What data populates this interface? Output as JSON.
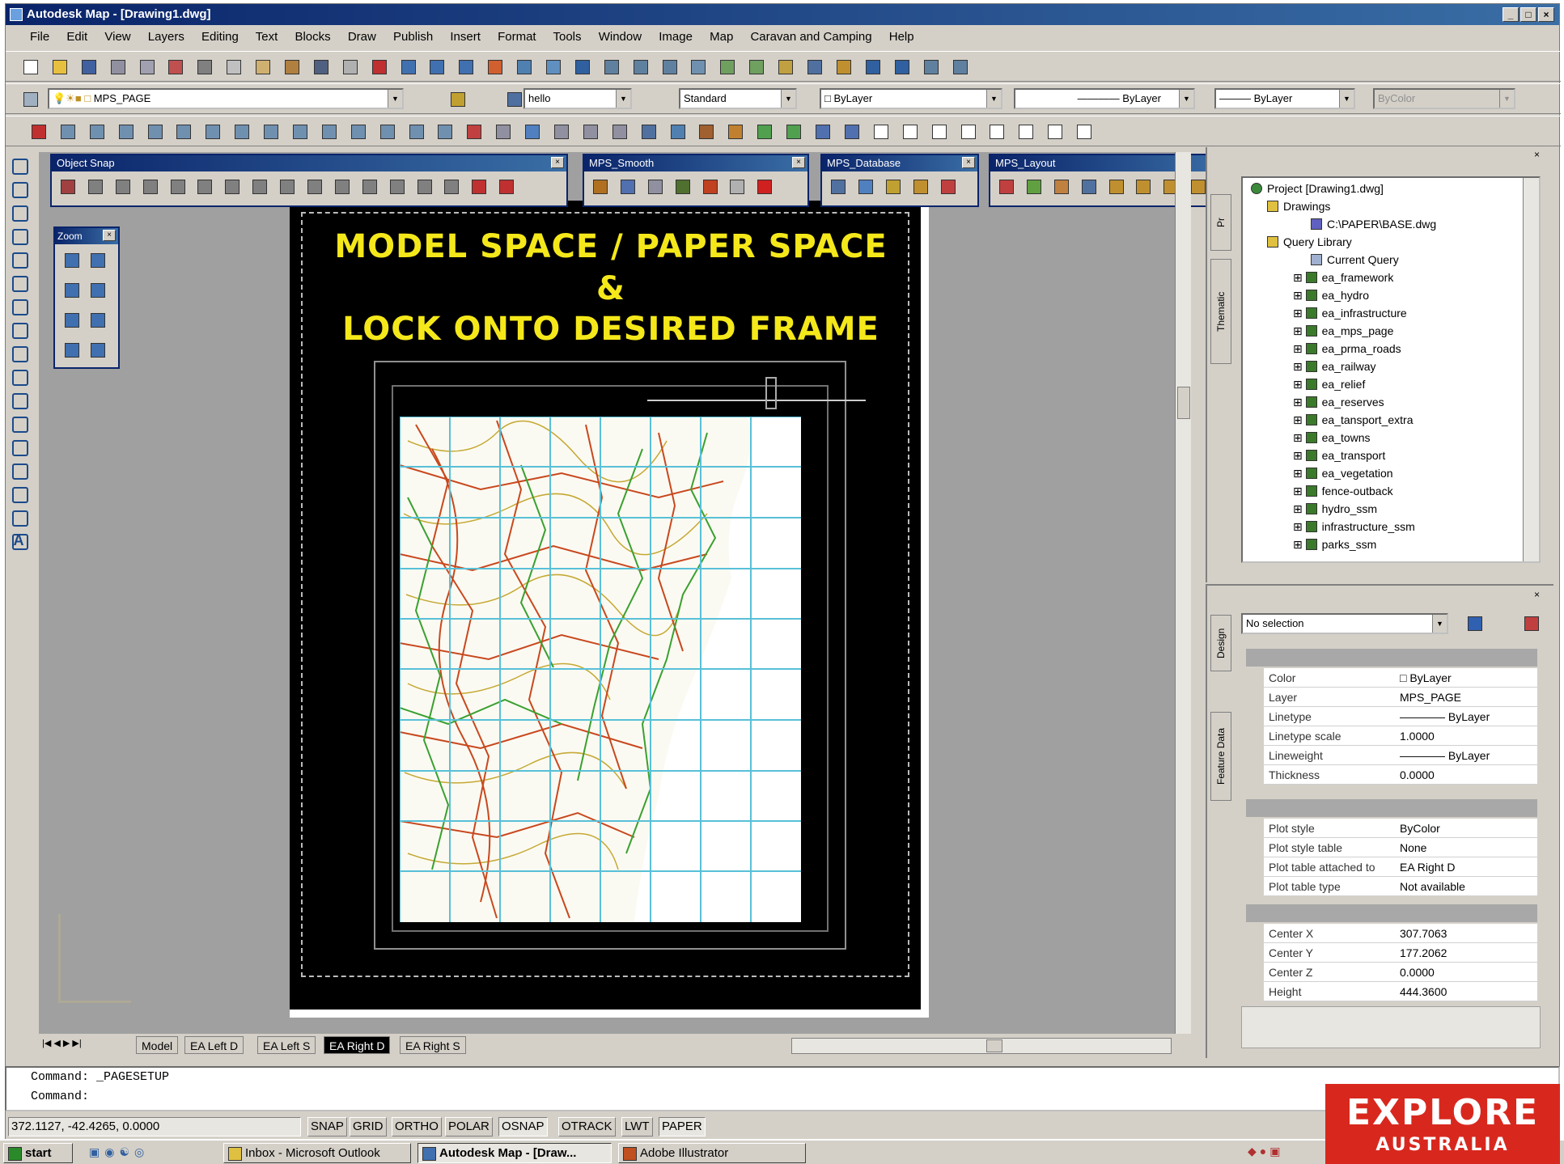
{
  "window": {
    "title": "Autodesk Map - [Drawing1.dwg]"
  },
  "menu": [
    "File",
    "Edit",
    "View",
    "Layers",
    "Editing",
    "Text",
    "Blocks",
    "Draw",
    "Publish",
    "Insert",
    "Format",
    "Tools",
    "Window",
    "Image",
    "Map",
    "Caravan and Camping",
    "Help"
  ],
  "layer_bar": {
    "layer": "MPS_PAGE",
    "text_style": "hello",
    "dim_style": "Standard",
    "color": "ByLayer",
    "linetype": "ByLayer",
    "lineweight": "ByLayer",
    "plotstyle": "ByColor"
  },
  "float_toolbars": {
    "object_snap": "Object Snap",
    "mps_smooth": "MPS_Smooth",
    "mps_database": "MPS_Database",
    "mps_layout": "MPS_Layout",
    "zoom": "Zoom"
  },
  "drawing": {
    "line1": "MODEL SPACE / PAPER SPACE",
    "line2": "&",
    "line3": "LOCK ONTO DESIRED FRAME"
  },
  "layout_tabs": [
    "Model",
    "EA Left D",
    "EA Left S",
    "EA Right D",
    "EA Right S"
  ],
  "active_tab_index": 3,
  "project_tree": {
    "root": "Project [Drawing1.dwg]",
    "drawings_label": "Drawings",
    "drawing_file": "C:\\PAPER\\BASE.dwg",
    "query_library": "Query Library",
    "current_query": "Current Query",
    "items": [
      "ea_framework",
      "ea_hydro",
      "ea_infrastructure",
      "ea_mps_page",
      "ea_prma_roads",
      "ea_railway",
      "ea_relief",
      "ea_reserves",
      "ea_tansport_extra",
      "ea_towns",
      "ea_transport",
      "ea_vegetation",
      "fence-outback",
      "hydro_ssm",
      "infrastructure_ssm",
      "parks_ssm"
    ]
  },
  "side_tabs": {
    "thematic": "Thematic",
    "design": "Design",
    "feature_data": "Feature Data"
  },
  "properties": {
    "selection": "No selection",
    "general": [
      {
        "k": "Color",
        "v": "ByLayer"
      },
      {
        "k": "Layer",
        "v": "MPS_PAGE"
      },
      {
        "k": "Linetype",
        "v": "ByLayer"
      },
      {
        "k": "Linetype scale",
        "v": "1.0000"
      },
      {
        "k": "Lineweight",
        "v": "ByLayer"
      },
      {
        "k": "Thickness",
        "v": "0.0000"
      }
    ],
    "plot": [
      {
        "k": "Plot style",
        "v": "ByColor"
      },
      {
        "k": "Plot style table",
        "v": "None"
      },
      {
        "k": "Plot table attached to",
        "v": "EA Right D"
      },
      {
        "k": "Plot table type",
        "v": "Not available"
      }
    ],
    "view": [
      {
        "k": "Center X",
        "v": "307.7063"
      },
      {
        "k": "Center Y",
        "v": "177.2062"
      },
      {
        "k": "Center Z",
        "v": "0.0000"
      },
      {
        "k": "Height",
        "v": "444.3600"
      }
    ]
  },
  "command": {
    "line1": "Command: _PAGESETUP",
    "line2": "Command:"
  },
  "status": {
    "coords": "372.1127, -42.4265, 0.0000",
    "toggles": [
      "SNAP",
      "GRID",
      "ORTHO",
      "POLAR",
      "OSNAP",
      "OTRACK",
      "LWT",
      "PAPER"
    ]
  },
  "taskbar": {
    "start": "start",
    "tasks": [
      "Inbox - Microsoft Outlook",
      "Autodesk Map - [Draw...",
      "Adobe Illustrator"
    ]
  },
  "brand": {
    "line1": "EXPLORE",
    "line2": "AUSTRALIA",
    "color": "#d8281e"
  },
  "colors": {
    "headline": "#f5e81a",
    "titlebar": "#0a246a"
  }
}
